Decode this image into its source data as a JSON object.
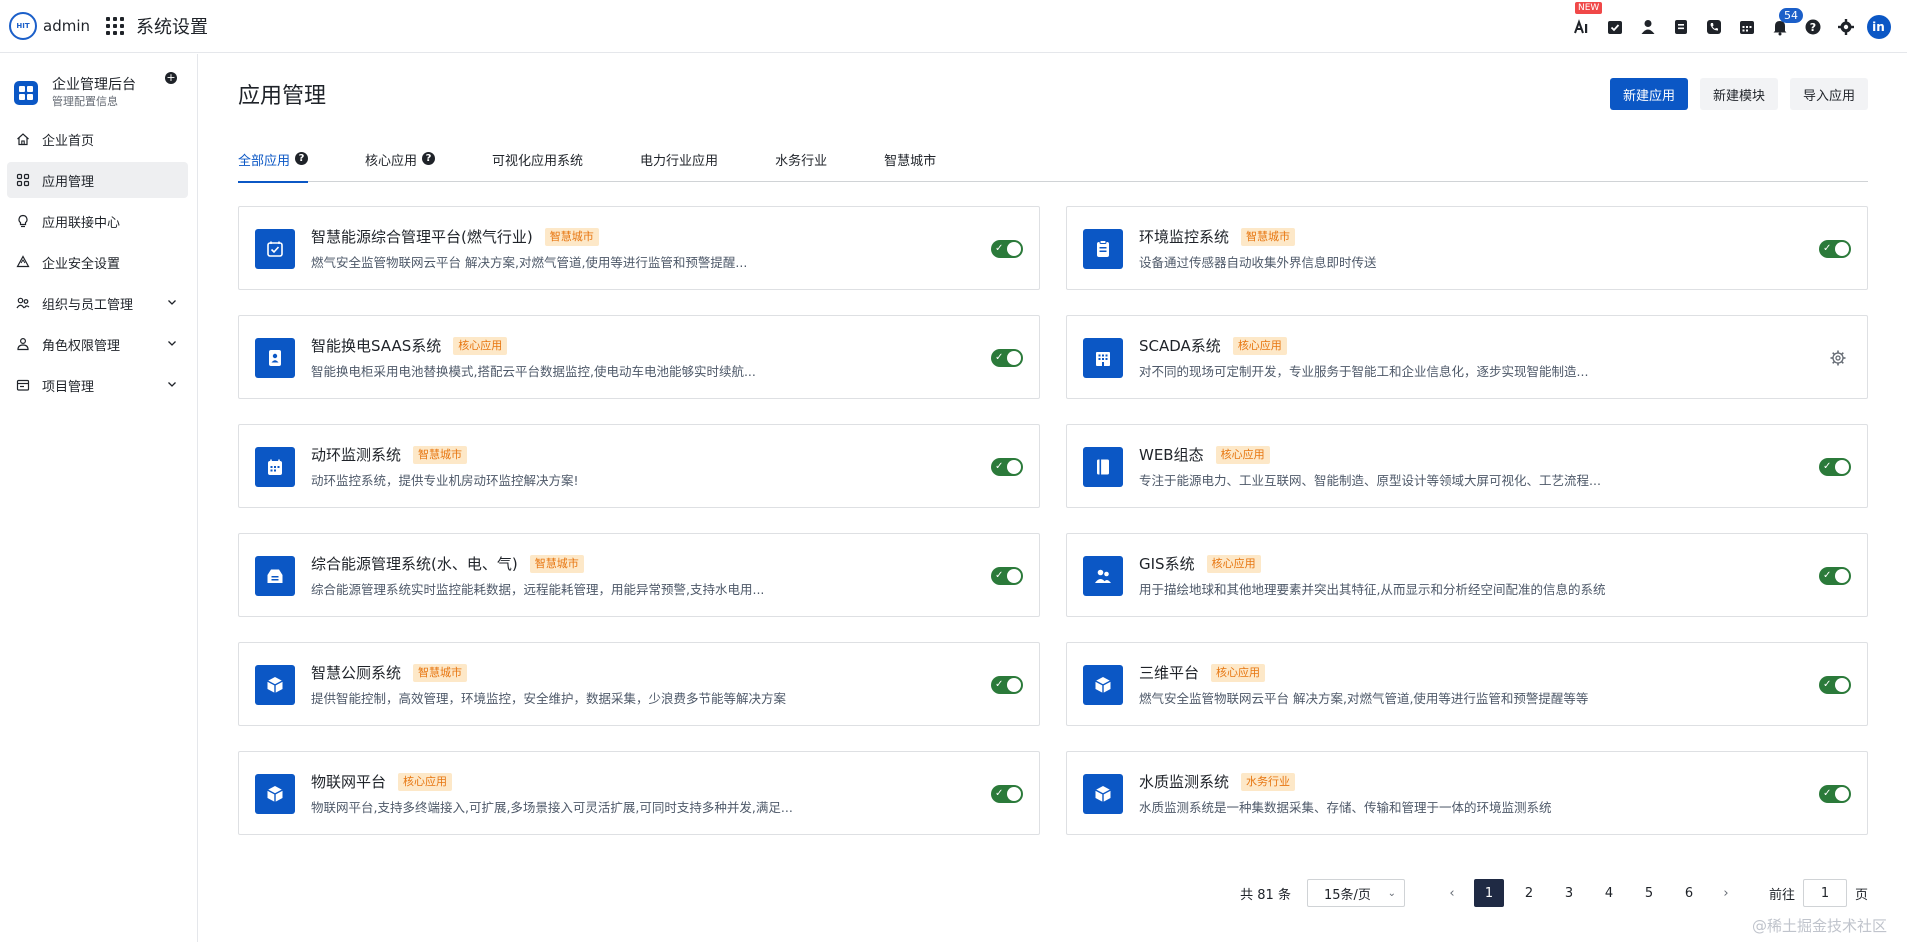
{
  "topbar": {
    "logo_text": "HIT",
    "user": "admin",
    "title": "系统设置",
    "new_badge": "NEW",
    "notification_count": "54",
    "avatar": "in"
  },
  "sidebar": {
    "org_title": "企业管理后台",
    "org_subtitle": "管理配置信息",
    "items": [
      {
        "label": "企业首页",
        "icon": "home-icon"
      },
      {
        "label": "应用管理",
        "icon": "apps-icon",
        "active": true
      },
      {
        "label": "应用联接中心",
        "icon": "bulb-icon"
      },
      {
        "label": "企业安全设置",
        "icon": "recycle-icon"
      },
      {
        "label": "组织与员工管理",
        "icon": "users-icon",
        "expandable": true
      },
      {
        "label": "角色权限管理",
        "icon": "role-icon",
        "expandable": true
      },
      {
        "label": "项目管理",
        "icon": "folder-icon",
        "expandable": true
      }
    ]
  },
  "main": {
    "title": "应用管理",
    "actions": {
      "new_app": "新建应用",
      "new_module": "新建模块",
      "import_app": "导入应用"
    },
    "tabs": [
      "全部应用",
      "核心应用",
      "可视化应用系统",
      "电力行业应用",
      "水务行业",
      "智慧城市"
    ],
    "cards": [
      {
        "title": "智慧能源综合管理平台(燃气行业)",
        "tag": "智慧城市",
        "desc": "燃气安全监管物联网云平台 解决方案,对燃气管道,使用等进行监管和预警提醒...",
        "icon": "calendar-check-icon",
        "control": "toggle",
        "enabled": true
      },
      {
        "title": "环境监控系统",
        "tag": "智慧城市",
        "desc": "设备通过传感器自动收集外界信息即时传送",
        "icon": "clipboard-icon",
        "control": "toggle",
        "enabled": true
      },
      {
        "title": "智能换电SAAS系统",
        "tag": "核心应用",
        "desc": "智能换电柜采用电池替换模式,搭配云平台数据监控,使电动车电池能够实时续航...",
        "icon": "id-card-icon",
        "control": "toggle",
        "enabled": true
      },
      {
        "title": "SCADA系统",
        "tag": "核心应用",
        "desc": "对不同的现场可定制开发，专业服务于智能工和企业信息化，逐步实现智能制造...",
        "icon": "building-icon",
        "control": "gear",
        "enabled": false
      },
      {
        "title": "动环监测系统",
        "tag": "智慧城市",
        "desc": "动环监控系统，提供专业机房动环监控解决方案!",
        "icon": "calendar-grid-icon",
        "control": "toggle",
        "enabled": true
      },
      {
        "title": "WEB组态",
        "tag": "核心应用",
        "desc": "专注于能源电力、工业互联网、智能制造、原型设计等领域大屏可视化、工艺流程...",
        "icon": "book-icon",
        "control": "toggle",
        "enabled": true
      },
      {
        "title": "综合能源管理系统(水、电、气)",
        "tag": "智慧城市",
        "desc": "综合能源管理系统实时监控能耗数据，远程能耗管理，用能异常预警,支持水电用...",
        "icon": "inbox-icon",
        "control": "toggle",
        "enabled": true
      },
      {
        "title": "GIS系统",
        "tag": "核心应用",
        "desc": "用于描绘地球和其他地理要素并突出其特征,从而显示和分析经空间配准的信息的系统",
        "icon": "people-icon",
        "control": "toggle",
        "enabled": true
      },
      {
        "title": "智慧公厕系统",
        "tag": "智慧城市",
        "desc": "提供智能控制，高效管理，环境监控，安全维护，数据采集，少浪费多节能等解决方案",
        "icon": "cube-icon",
        "control": "toggle",
        "enabled": true
      },
      {
        "title": "三维平台",
        "tag": "核心应用",
        "desc": "燃气安全监管物联网云平台 解决方案,对燃气管道,使用等进行监管和预警提醒等等",
        "icon": "cube-icon",
        "control": "toggle",
        "enabled": true
      },
      {
        "title": "物联网平台",
        "tag": "核心应用",
        "desc": "物联网平台,支持多终端接入,可扩展,多场景接入可灵活扩展,可同时支持多种并发,满足...",
        "icon": "cube-icon",
        "control": "toggle",
        "enabled": true
      },
      {
        "title": "水质监测系统",
        "tag": "水务行业",
        "desc": "水质监测系统是一种集数据采集、存储、传输和管理于一体的环境监测系统",
        "icon": "cube-icon",
        "control": "toggle",
        "enabled": true
      }
    ]
  },
  "pagination": {
    "total": "共 81 条",
    "page_size": "15条/页",
    "pages": [
      "1",
      "2",
      "3",
      "4",
      "5",
      "6"
    ],
    "current": "1",
    "goto_label": "前往",
    "goto_value": "1",
    "page_suffix": "页"
  },
  "watermark": "@稀土掘金技术社区",
  "colors": {
    "primary": "#0b57c5",
    "toggle_on": "#2b7a3a",
    "tag_bg": "#fde8c8",
    "tag_text": "#e77611"
  }
}
